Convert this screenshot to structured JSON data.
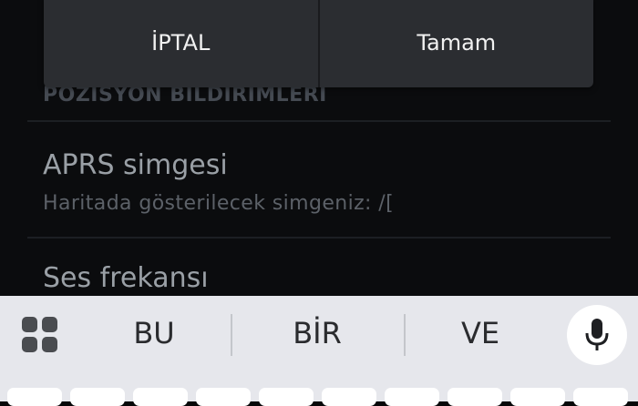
{
  "dialog": {
    "cancel_label": "İPTAL",
    "ok_label": "Tamam"
  },
  "settings": {
    "section_header": "POZISYON BILDIRIMLERI",
    "prefs": [
      {
        "title": "APRS simgesi",
        "summary": "Haritada gösterilecek simgeniz: /["
      },
      {
        "title": "Ses frekansı"
      }
    ]
  },
  "keyboard": {
    "suggestions": [
      "BU",
      "BİR",
      "VE"
    ],
    "grid_icon": "apps-grid-icon",
    "mic_icon": "microphone-icon"
  }
}
